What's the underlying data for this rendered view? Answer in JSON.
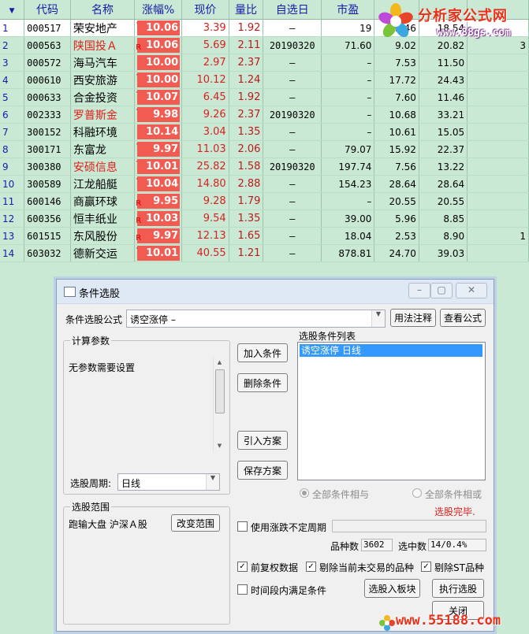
{
  "table": {
    "headers": {
      "sort": "▼",
      "code": "代码",
      "name": "名称",
      "pct": "涨幅%",
      "price": "现价",
      "ratio": "量比",
      "date": "自选日",
      "mv": "市盈",
      "pe": "",
      "pe2": "",
      "extra": ""
    },
    "rows": [
      {
        "idx": "1",
        "code": "000517",
        "name": "荣安地产",
        "name_red": false,
        "flag": "·",
        "pct": "10.06",
        "price": "3.39",
        "ratio": "1.92",
        "date": "–",
        "mv": "19",
        "pe": "3.46",
        "pe2": "18.54",
        "extra": ""
      },
      {
        "idx": "2",
        "code": "000563",
        "name": "陕国投Ａ",
        "name_red": true,
        "flag": "R",
        "pct": "10.06",
        "price": "5.69",
        "ratio": "2.11",
        "date": "20190320",
        "mv": "71.60",
        "pe": "9.02",
        "pe2": "20.82",
        "extra": "3"
      },
      {
        "idx": "3",
        "code": "000572",
        "name": "海马汽车",
        "name_red": false,
        "flag": "",
        "pct": "10.00",
        "price": "2.97",
        "ratio": "2.37",
        "date": "–",
        "mv": "–",
        "pe": "7.53",
        "pe2": "11.50",
        "extra": ""
      },
      {
        "idx": "4",
        "code": "000610",
        "name": "西安旅游",
        "name_red": false,
        "flag": "·",
        "pct": "10.00",
        "price": "10.12",
        "ratio": "1.24",
        "date": "–",
        "mv": "–",
        "pe": "17.72",
        "pe2": "24.43",
        "extra": ""
      },
      {
        "idx": "5",
        "code": "000633",
        "name": "合金投资",
        "name_red": false,
        "flag": "·",
        "pct": "10.07",
        "price": "6.45",
        "ratio": "1.92",
        "date": "–",
        "mv": "–",
        "pe": "7.60",
        "pe2": "11.46",
        "extra": ""
      },
      {
        "idx": "6",
        "code": "002333",
        "name": "罗普斯金",
        "name_red": true,
        "flag": "·",
        "pct": "9.98",
        "price": "9.26",
        "ratio": "2.37",
        "date": "20190320",
        "mv": "–",
        "pe": "10.68",
        "pe2": "33.21",
        "extra": ""
      },
      {
        "idx": "7",
        "code": "300152",
        "name": "科融环境",
        "name_red": false,
        "flag": "",
        "pct": "10.14",
        "price": "3.04",
        "ratio": "1.35",
        "date": "–",
        "mv": "–",
        "pe": "10.61",
        "pe2": "15.05",
        "extra": ""
      },
      {
        "idx": "8",
        "code": "300171",
        "name": "东富龙",
        "name_red": false,
        "flag": "·",
        "pct": "9.97",
        "price": "11.03",
        "ratio": "2.06",
        "date": "–",
        "mv": "79.07",
        "pe": "15.92",
        "pe2": "22.37",
        "extra": ""
      },
      {
        "idx": "9",
        "code": "300380",
        "name": "安硕信息",
        "name_red": true,
        "flag": "·",
        "pct": "10.01",
        "price": "25.82",
        "ratio": "1.58",
        "date": "20190320",
        "mv": "197.74",
        "pe": "7.56",
        "pe2": "13.22",
        "extra": ""
      },
      {
        "idx": "10",
        "code": "300589",
        "name": "江龙船艇",
        "name_red": false,
        "flag": "·",
        "pct": "10.04",
        "price": "14.80",
        "ratio": "2.88",
        "date": "–",
        "mv": "154.23",
        "pe": "28.64",
        "pe2": "28.64",
        "extra": ""
      },
      {
        "idx": "11",
        "code": "600146",
        "name": "商赢环球",
        "name_red": false,
        "flag": "R",
        "pct": "9.95",
        "price": "9.28",
        "ratio": "1.79",
        "date": "–",
        "mv": "–",
        "pe": "20.55",
        "pe2": "20.55",
        "extra": ""
      },
      {
        "idx": "12",
        "code": "600356",
        "name": "恒丰纸业",
        "name_red": false,
        "flag": "R",
        "pct": "10.03",
        "price": "9.54",
        "ratio": "1.35",
        "date": "–",
        "mv": "39.00",
        "pe": "5.96",
        "pe2": "8.85",
        "extra": ""
      },
      {
        "idx": "13",
        "code": "601515",
        "name": "东风股份",
        "name_red": false,
        "flag": "R",
        "pct": "9.97",
        "price": "12.13",
        "ratio": "1.65",
        "date": "–",
        "mv": "18.04",
        "pe": "2.53",
        "pe2": "8.90",
        "extra": "1"
      },
      {
        "idx": "14",
        "code": "603032",
        "name": "德新交运",
        "name_red": false,
        "flag": "·",
        "pct": "10.01",
        "price": "40.55",
        "ratio": "1.21",
        "date": "–",
        "mv": "878.81",
        "pe": "24.70",
        "pe2": "39.03",
        "extra": ""
      }
    ]
  },
  "watermark_top": {
    "brand": "分析家公式网",
    "url": "www.88gs.com"
  },
  "watermark_bottom": {
    "url": "www.55188.com"
  },
  "dialog": {
    "title": "条件选股",
    "formula_label": "条件选股公式",
    "formula_value": "诱空涨停        –",
    "btn_usage": "用法注释",
    "btn_view": "查看公式",
    "params_group": "计算参数",
    "params_text": "无参数需要设置",
    "period_label": "选股周期:",
    "period_value": "日线",
    "scope_group": "选股范围",
    "scope_text": "跑输大盘 沪深Ａ股",
    "btn_change_scope": "改变范围",
    "btn_add": "加入条件",
    "btn_delete": "删除条件",
    "btn_import": "引入方案",
    "btn_save": "保存方案",
    "cond_list_label": "选股条件列表",
    "cond_items": [
      "诱空涨停   日线"
    ],
    "radio_and": "全部条件相与",
    "radio_or": "全部条件相或",
    "status": "选股完毕.",
    "chk_irregular": "使用涨跌不定周期",
    "count_label": "品种数",
    "count_value": "3602",
    "selected_label": "选中数",
    "selected_value": "14/0.4%",
    "chk_adjust": "前复权数据",
    "chk_exclude_untraded": "剔除当前未交易的品种",
    "chk_exclude_st": "剔除ST品种",
    "chk_time_range": "时间段内满足条件",
    "btn_to_block": "选股入板块",
    "btn_run": "执行选股",
    "btn_close": "关闭",
    "colors": {
      "accent": "#3399ff",
      "status": "#e0201a"
    }
  }
}
